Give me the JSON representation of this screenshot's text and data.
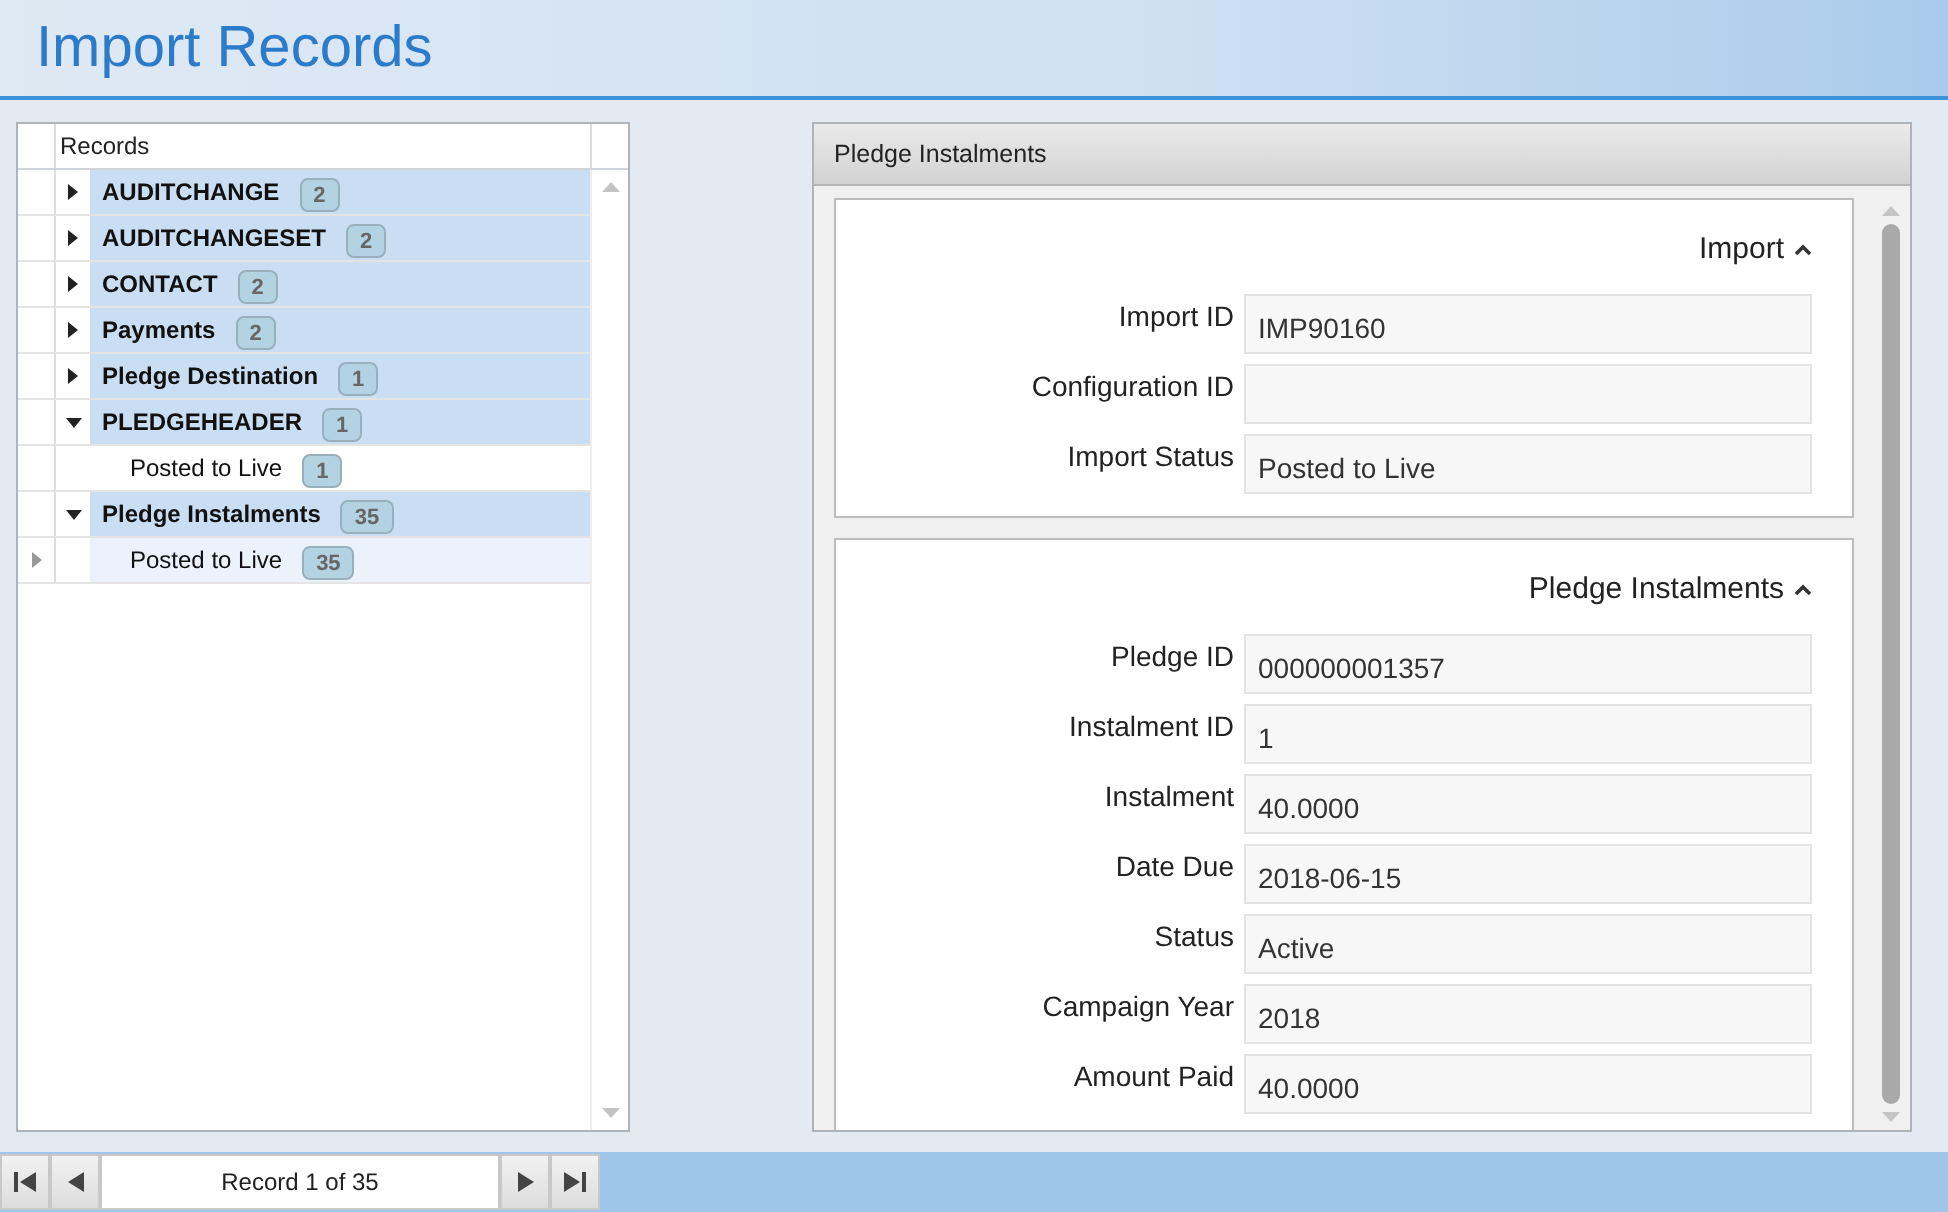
{
  "window": {
    "title": "Import Records"
  },
  "records_grid": {
    "column": "Records",
    "rows": [
      {
        "label": "AUDITCHANGE",
        "count": "2",
        "expanded": false,
        "selected": false
      },
      {
        "label": "AUDITCHANGESET",
        "count": "2",
        "expanded": false,
        "selected": false
      },
      {
        "label": "CONTACT",
        "count": "2",
        "expanded": false,
        "selected": false
      },
      {
        "label": "Payments",
        "count": "2",
        "expanded": false,
        "selected": false
      },
      {
        "label": "Pledge Destination",
        "count": "1",
        "expanded": false,
        "selected": false
      },
      {
        "label": "PLEDGEHEADER",
        "count": "1",
        "expanded": true,
        "selected": false,
        "children": [
          {
            "label": "Posted to Live",
            "count": "1",
            "selected": false
          }
        ]
      },
      {
        "label": "Pledge Instalments",
        "count": "35",
        "expanded": true,
        "selected": false,
        "children": [
          {
            "label": "Posted to Live",
            "count": "35",
            "selected": true
          }
        ]
      }
    ]
  },
  "detail_panel": {
    "title": "Pledge Instalments",
    "sections": [
      {
        "title": "Import",
        "expanded": true,
        "fields": [
          {
            "label": "Import ID",
            "value": "IMP90160"
          },
          {
            "label": "Configuration ID"
          },
          {
            "label": "Import Status",
            "value": "Posted to Live"
          }
        ]
      },
      {
        "title": "Pledge Instalments",
        "expanded": true,
        "fields": [
          {
            "label": "Pledge ID",
            "value": "000000001357"
          },
          {
            "label": "Instalment ID",
            "value": "1"
          },
          {
            "label": "Instalment",
            "value": "40.0000"
          },
          {
            "label": "Date Due",
            "value": "2018-06-15"
          },
          {
            "label": "Status",
            "value": "Active"
          },
          {
            "label": "Campaign Year",
            "value": "2018"
          },
          {
            "label": "Amount Paid",
            "value": "40.0000"
          }
        ]
      }
    ]
  },
  "pager": {
    "text": "Record 1 of 35"
  }
}
